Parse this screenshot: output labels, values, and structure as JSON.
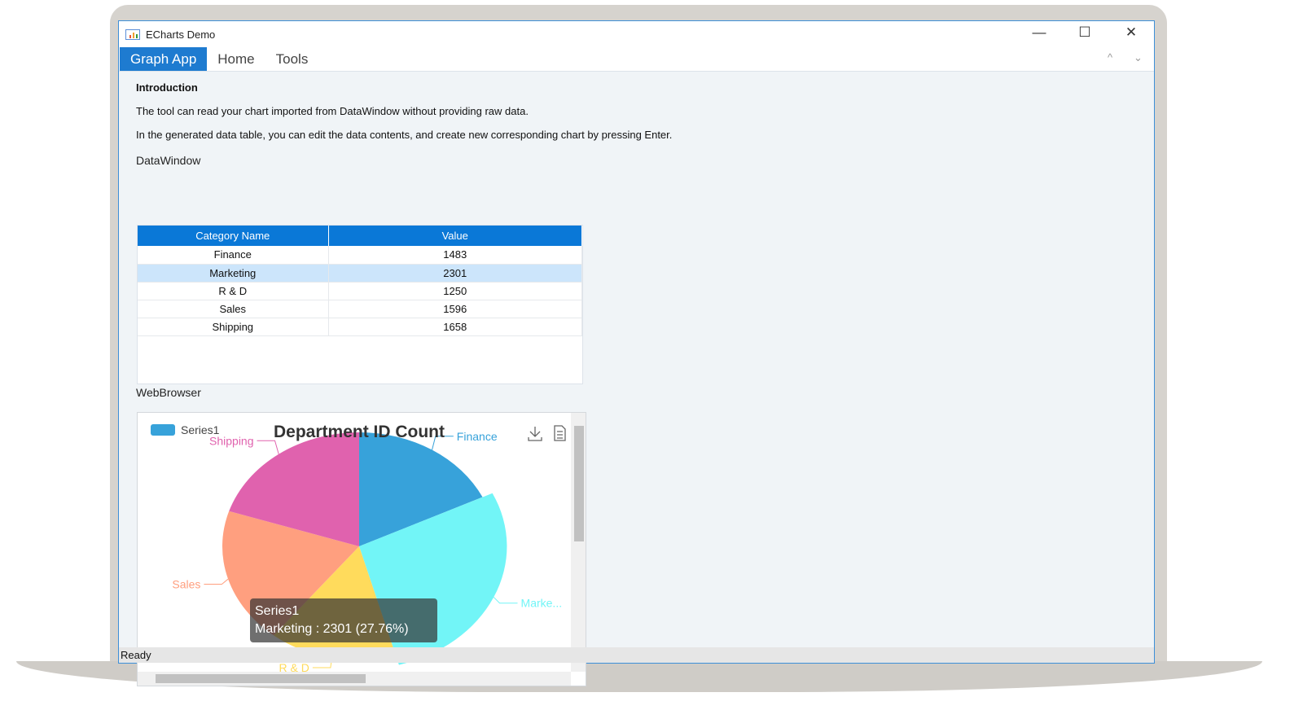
{
  "window": {
    "title": "ECharts Demo",
    "minimize": "—",
    "maximize": "☐",
    "close": "✕"
  },
  "menu": {
    "tabs": [
      "Graph App",
      "Home",
      "Tools"
    ],
    "collapse": "^",
    "expand": "⌄"
  },
  "intro": {
    "heading": "Introduction",
    "line1": "The tool can read your chart imported from DataWindow without providing raw data.",
    "line2": "In the generated data table, you can edit the data contents, and create new corresponding chart by pressing Enter."
  },
  "datawindow": {
    "label": "DataWindow",
    "columns": [
      "Category Name",
      "Value"
    ],
    "rows": [
      [
        "Finance",
        "1483"
      ],
      [
        "Marketing",
        "2301"
      ],
      [
        "R & D",
        "1250"
      ],
      [
        "Sales",
        "1596"
      ],
      [
        "Shipping",
        "1658"
      ]
    ],
    "selected_row": 1
  },
  "webbrowser": {
    "label": "WebBrowser"
  },
  "chart_data": {
    "type": "pie",
    "title": "Department ID Count",
    "legend": [
      "Series1"
    ],
    "legend_placement": "top-left",
    "series_name": "Series1",
    "categories": [
      "Finance",
      "Marketing",
      "R & D",
      "Sales",
      "Shipping"
    ],
    "values": [
      1483,
      2301,
      1250,
      1596,
      1658
    ],
    "labels": [
      "Finance",
      "Marke...",
      "R & D",
      "Sales",
      "Shipping"
    ],
    "colors": [
      "#37a2da",
      "#72f5f7",
      "#ffdb5c",
      "#ff9f7f",
      "#e062ae"
    ],
    "highlighted": "Marketing",
    "tooltip": {
      "title": "Series1",
      "text": "Marketing : 2301 (27.76%)"
    }
  },
  "status": "Ready"
}
